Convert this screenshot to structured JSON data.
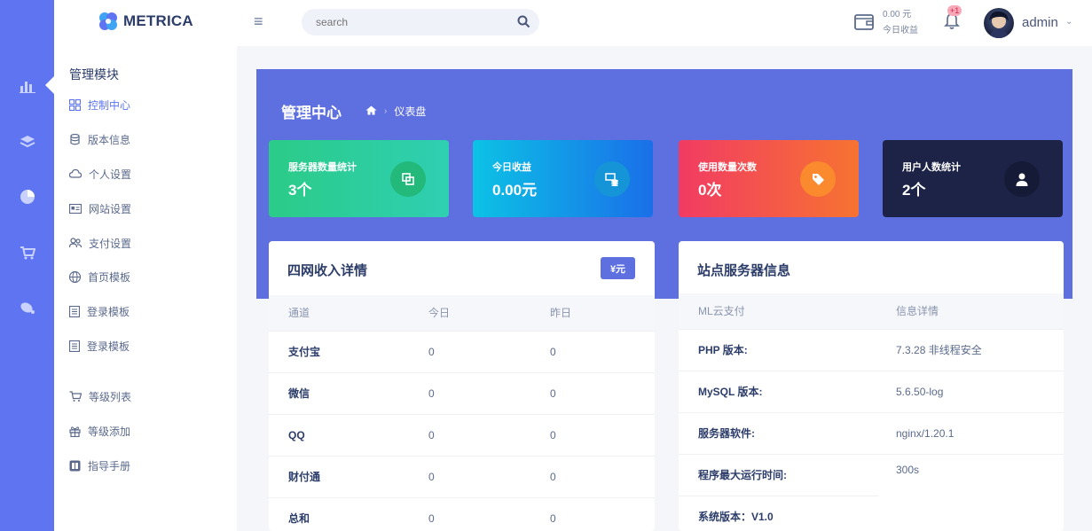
{
  "app": {
    "brand": "METRICA"
  },
  "search": {
    "placeholder": "search"
  },
  "header": {
    "balance": "0.00 元",
    "balance_label": "今日收益",
    "notif_count": "+1",
    "username": "admin"
  },
  "sidebar": {
    "title": "管理模块",
    "items": [
      {
        "label": "控制中心",
        "icon": "dashboard-grid-icon",
        "active": true
      },
      {
        "label": "版本信息",
        "icon": "database-icon"
      },
      {
        "label": "个人设置",
        "icon": "cloud-icon"
      },
      {
        "label": "网站设置",
        "icon": "id-card-icon"
      },
      {
        "label": "支付设置",
        "icon": "users-icon"
      },
      {
        "label": "首页模板",
        "icon": "globe-icon"
      },
      {
        "label": "登录模板",
        "icon": "list-icon"
      },
      {
        "label": "登录模板",
        "icon": "list-icon"
      },
      {
        "label": "等级列表",
        "icon": "cart-icon"
      },
      {
        "label": "等级添加",
        "icon": "gift-icon"
      },
      {
        "label": "指导手册",
        "icon": "book-icon"
      }
    ]
  },
  "page": {
    "title": "管理中心",
    "breadcrumb": "仪表盘"
  },
  "stats": [
    {
      "label": "服务器数量统计",
      "value": "3个",
      "icon": "copy-icon"
    },
    {
      "label": "今日收益",
      "value": "0.00元",
      "icon": "money-stack-icon"
    },
    {
      "label": "使用数量次数",
      "value": "0次",
      "icon": "tag-icon"
    },
    {
      "label": "用户人数统计",
      "value": "2个",
      "icon": "user-icon"
    }
  ],
  "income": {
    "title": "四网收入详情",
    "unit_button": "¥元",
    "columns": [
      "通道",
      "今日",
      "昨日"
    ],
    "rows": [
      [
        "支付宝",
        "0",
        "0"
      ],
      [
        "微信",
        "0",
        "0"
      ],
      [
        "QQ",
        "0",
        "0"
      ],
      [
        "财付通",
        "0",
        "0"
      ],
      [
        "总和",
        "0",
        "0"
      ]
    ]
  },
  "server": {
    "title": "站点服务器信息",
    "columns": [
      "ML云支付",
      "信息详情"
    ],
    "rows": [
      [
        "PHP 版本:",
        "7.3.28 非线程安全"
      ],
      [
        "MySQL 版本:",
        "5.6.50-log"
      ],
      [
        "服务器软件:",
        "nginx/1.20.1"
      ],
      [
        "程序最大运行时间:",
        "300s"
      ],
      [
        "系统版本：V1.0",
        ""
      ]
    ]
  }
}
